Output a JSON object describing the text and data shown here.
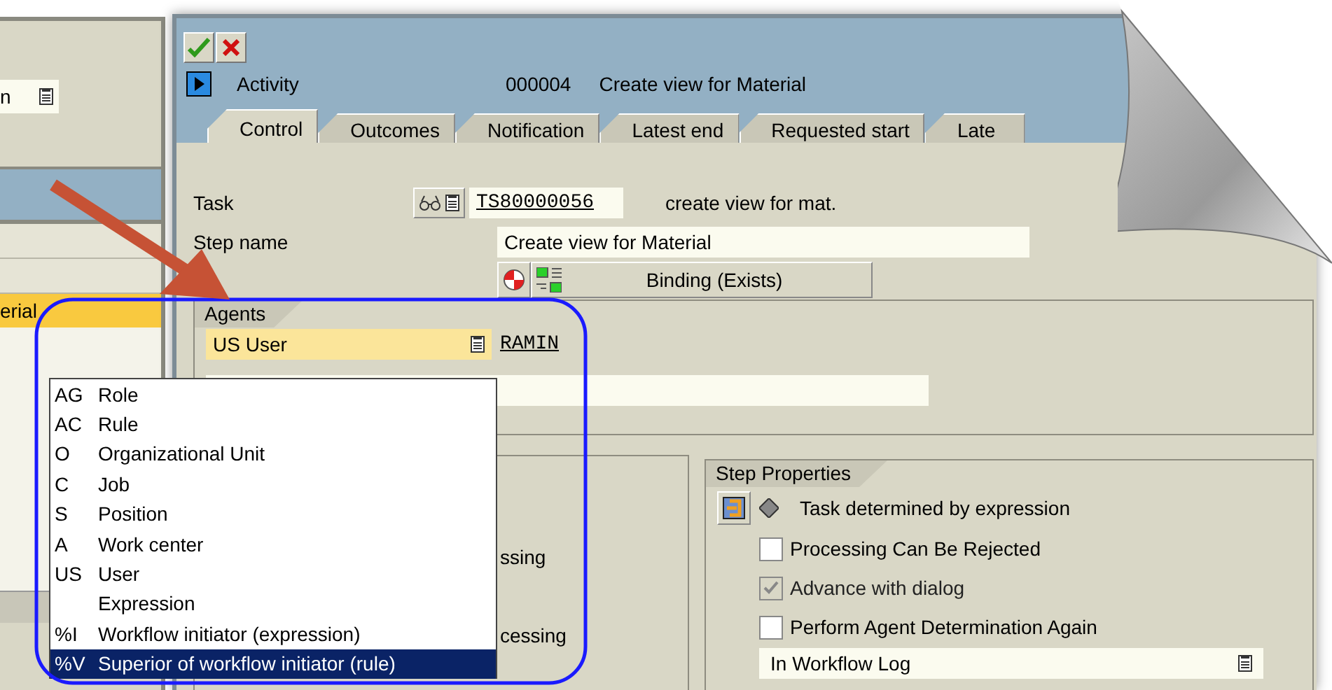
{
  "left_panel": {
    "field_value": "n",
    "highlighted_row": "erial"
  },
  "header": {
    "object_type": "Activity",
    "number": "000004",
    "description": "Create view for Material"
  },
  "tabs": [
    {
      "label": "Control",
      "selected": true
    },
    {
      "label": "Outcomes",
      "selected": false
    },
    {
      "label": "Notification",
      "selected": false
    },
    {
      "label": "Latest end",
      "selected": false
    },
    {
      "label": "Requested start",
      "selected": false
    },
    {
      "label": "Late",
      "selected": false
    }
  ],
  "task": {
    "label": "Task",
    "value": "TS80000056",
    "description": "create view for mat."
  },
  "step_name": {
    "label": "Step name",
    "value": "Create view for Material"
  },
  "binding_button": "Binding (Exists)",
  "agents": {
    "title": "Agents",
    "type_field": "US User",
    "agent_id": "RAMIN",
    "dropdown": {
      "items": [
        {
          "code": "AG",
          "text": "Role",
          "selected": false
        },
        {
          "code": "AC",
          "text": "Rule",
          "selected": false
        },
        {
          "code": "O",
          "text": "Organizational Unit",
          "selected": false
        },
        {
          "code": "C",
          "text": "Job",
          "selected": false
        },
        {
          "code": "S",
          "text": "Position",
          "selected": false
        },
        {
          "code": "A",
          "text": "Work center",
          "selected": false
        },
        {
          "code": "US",
          "text": "User",
          "selected": false
        },
        {
          "text": "Expression",
          "selected": false
        },
        {
          "code": "%I",
          "text": "Workflow initiator (expression)",
          "selected": false
        },
        {
          "code": "%V",
          "text": "Superior of workflow initiator (rule)",
          "selected": true
        }
      ]
    }
  },
  "processing_group": {
    "texts": [
      "ssing",
      "cessing"
    ]
  },
  "step_properties": {
    "title": "Step Properties",
    "task_mode": "Task determined by expression",
    "checkboxes": [
      {
        "label": "Processing Can Be Rejected",
        "checked": false,
        "disabled": false
      },
      {
        "label": "Advance with dialog",
        "checked": true,
        "disabled": true
      },
      {
        "label": "Perform Agent Determination Again",
        "checked": false,
        "disabled": false
      }
    ],
    "log_field": "In Workflow Log"
  }
}
